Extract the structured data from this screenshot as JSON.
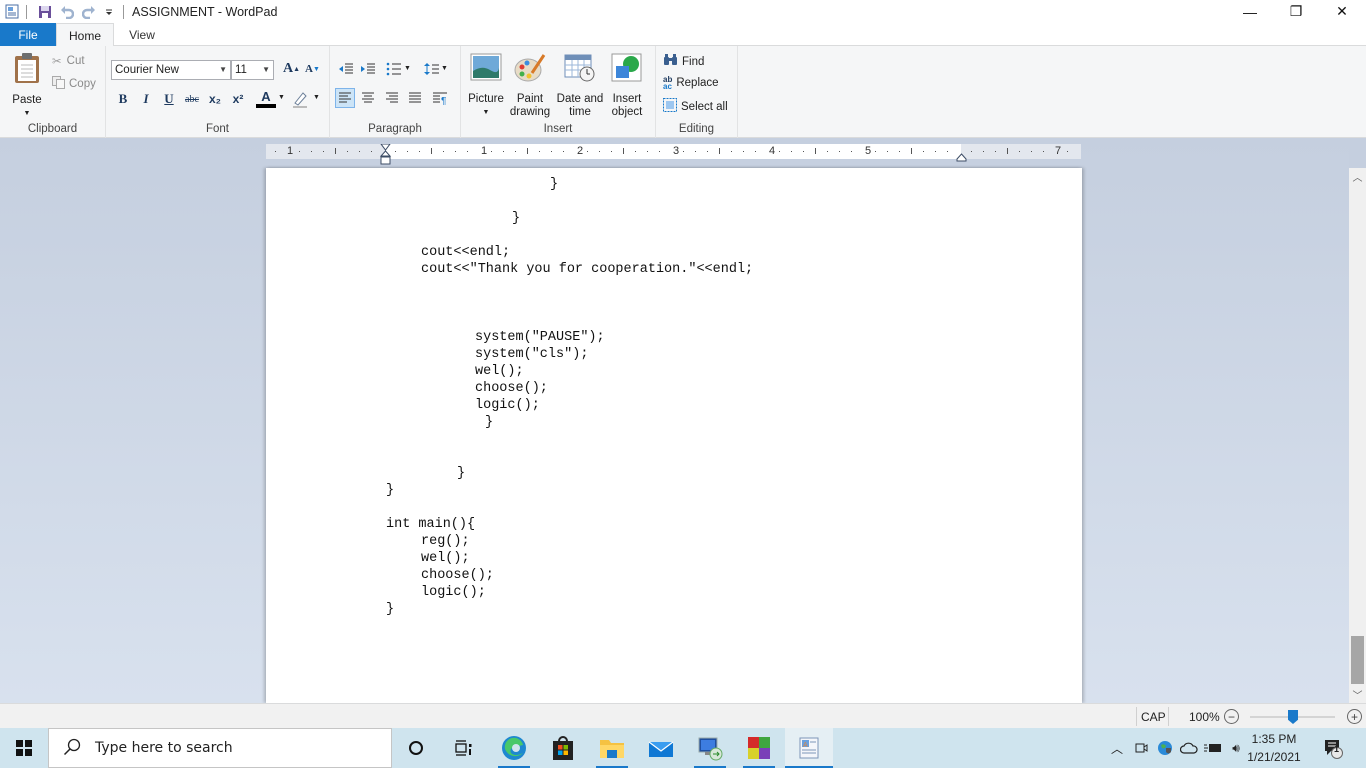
{
  "window": {
    "title": "ASSIGNMENT - WordPad",
    "quick_access": [
      "wordpad-app-icon",
      "save-icon",
      "undo-icon",
      "redo-icon",
      "customize-dropdown-icon"
    ],
    "controls": {
      "minimize": "—",
      "restore": "❐",
      "close": "✕"
    }
  },
  "ribbon": {
    "tabs": [
      {
        "label": "File",
        "active": false
      },
      {
        "label": "Home",
        "active": true
      },
      {
        "label": "View",
        "active": false
      }
    ],
    "help": "?",
    "collapse": "^",
    "clipboard": {
      "label": "Clipboard",
      "paste": "Paste",
      "cut": "Cut",
      "copy": "Copy"
    },
    "font": {
      "label": "Font",
      "family": "Courier New",
      "size": "11",
      "grow": "A",
      "shrink": "A",
      "bold": "B",
      "italic": "I",
      "underline": "U",
      "strikethrough": "abc",
      "subscript": "x₂",
      "superscript": "x²",
      "text_color": "A",
      "text_color_hex": "#000000"
    },
    "paragraph": {
      "label": "Paragraph"
    },
    "insert": {
      "label": "Insert",
      "picture": "Picture",
      "paint_1": "Paint",
      "paint_2": "drawing",
      "datetime_1": "Date and",
      "datetime_2": "time",
      "object_1": "Insert",
      "object_2": "object"
    },
    "editing": {
      "label": "Editing",
      "find": "Find",
      "replace": "Replace",
      "select_all": "Select all"
    }
  },
  "ruler": {
    "numbers": [
      "1",
      "1",
      "2",
      "3",
      "4",
      "5",
      "7"
    ]
  },
  "document": {
    "lines": [
      "                  }",
      "                }",
      "",
      "    cout<<endl;",
      "    cout<<\"Thank you for cooperation.\"<<endl;",
      "",
      "",
      "",
      "          system(\"PAUSE\");",
      "          system(\"cls\");",
      "          wel();",
      "          choose();",
      "          logic();",
      "           }",
      "",
      "",
      "         }",
      "}",
      "",
      "int main(){",
      "    reg();",
      "    wel();",
      "    choose();",
      "    logic();",
      "}"
    ]
  },
  "statusbar": {
    "caps": "CAP",
    "zoom": "100%",
    "zoom_minus": "−",
    "zoom_plus": "+",
    "zoom_level_percent": 100
  },
  "taskbar": {
    "search_placeholder": "Type here to search",
    "apps": [
      "cortana",
      "task-view",
      "edge",
      "store",
      "file-explorer",
      "mail",
      "remote-desktop",
      "app-colorful",
      "wordpad"
    ],
    "time": "1:35 PM",
    "date": "1/21/2021",
    "notifications": "1"
  }
}
